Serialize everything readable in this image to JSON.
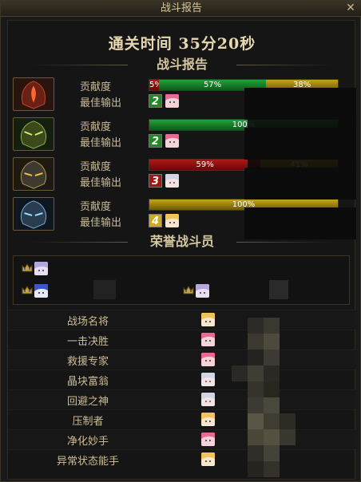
{
  "window": {
    "title": "战斗报告",
    "close_glyph": "✕"
  },
  "clear_time": "通关时间  35分20秒",
  "sections": {
    "battle_report": "战斗报告",
    "honor": "荣誉战斗员"
  },
  "labels": {
    "contribution": "贡献度",
    "best_output": "最佳输出"
  },
  "players": [
    {
      "job_icon": "red-flame-mask-icon",
      "contribution": [
        {
          "color": "red",
          "value": 5,
          "label": "5%"
        },
        {
          "color": "green",
          "value": 57,
          "label": "57%"
        },
        {
          "color": "yellow",
          "value": 38,
          "label": "38%"
        }
      ],
      "best_rank": "2",
      "best_rank_color": "green",
      "best_avatar": "pink-hair-avatar-icon"
    },
    {
      "job_icon": "green-mask-icon",
      "contribution": [
        {
          "color": "green",
          "value": 100,
          "label": "100%"
        }
      ],
      "best_rank": "2",
      "best_rank_color": "green",
      "best_avatar": "pink-hair-avatar-icon"
    },
    {
      "job_icon": "gold-mask-icon",
      "contribution": [
        {
          "color": "red",
          "value": 59,
          "label": "59%"
        },
        {
          "color": "yellow",
          "value": 41,
          "label": "41%"
        }
      ],
      "best_rank": "3",
      "best_rank_color": "red",
      "best_avatar": "white-hair-avatar-icon"
    },
    {
      "job_icon": "blue-mask-icon",
      "contribution": [
        {
          "color": "yellow",
          "value": 100,
          "label": "100%"
        }
      ],
      "best_rank": "4",
      "best_rank_color": "yellow",
      "best_avatar": "blonde-avatar-icon"
    }
  ],
  "honor_members": [
    {
      "crown": "crown-icon",
      "avatar": "lavender-hair-avatar-icon"
    },
    {
      "crown": "crown-icon",
      "avatar": "blue-hair-avatar-icon"
    },
    {
      "crown": "crown-icon",
      "avatar": "lavender-hair-avatar-icon"
    }
  ],
  "titles": [
    {
      "name": "战场名将",
      "avatar": "blonde-avatar-icon"
    },
    {
      "name": "一击决胜",
      "avatar": "pink-hair-avatar-icon"
    },
    {
      "name": "救援专家",
      "avatar": "pink-hair-avatar-icon"
    },
    {
      "name": "晶块富翁",
      "avatar": "white-hair-avatar-icon"
    },
    {
      "name": "回避之神",
      "avatar": "white-hair-avatar-icon"
    },
    {
      "name": "压制者",
      "avatar": "blonde-avatar-icon"
    },
    {
      "name": "净化妙手",
      "avatar": "pink-hair-avatar-icon"
    },
    {
      "name": "异常状态能手",
      "avatar": "blonde-avatar-icon"
    }
  ]
}
